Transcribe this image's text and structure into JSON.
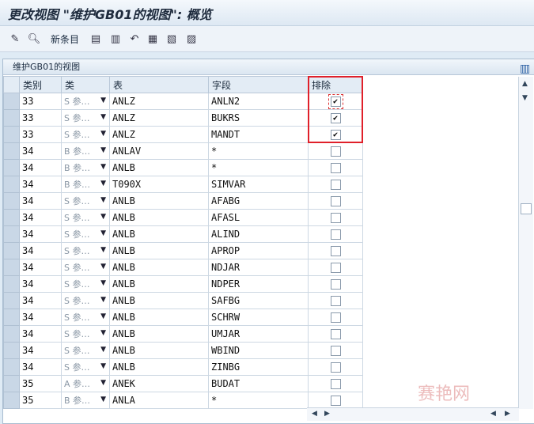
{
  "window": {
    "title": "更改视图 \"维护GB01的视图\": 概览"
  },
  "toolbar": {
    "new_entries_label": "新条目",
    "icons": [
      "edit-icon",
      "find-icon",
      "copy-icon",
      "delete-icon",
      "undo-icon",
      "select-all-icon",
      "select-block-icon",
      "deselect-all-icon"
    ]
  },
  "panel": {
    "title": "维护GB01的视图"
  },
  "table": {
    "headers": {
      "category": "类别",
      "class": "类",
      "table": "表",
      "field": "字段",
      "exclude": "排除"
    },
    "rows": [
      {
        "cat": "33",
        "cls": "S 参…",
        "tab": "ANLZ",
        "field": "ANLN2",
        "ex": true
      },
      {
        "cat": "33",
        "cls": "S 参…",
        "tab": "ANLZ",
        "field": "BUKRS",
        "ex": true
      },
      {
        "cat": "33",
        "cls": "S 参…",
        "tab": "ANLZ",
        "field": "MANDT",
        "ex": true
      },
      {
        "cat": "34",
        "cls": "B 参…",
        "tab": "ANLAV",
        "field": "*",
        "ex": false
      },
      {
        "cat": "34",
        "cls": "B 参…",
        "tab": "ANLB",
        "field": "*",
        "ex": false
      },
      {
        "cat": "34",
        "cls": "B 参…",
        "tab": "T090X",
        "field": "SIMVAR",
        "ex": false
      },
      {
        "cat": "34",
        "cls": "S 参…",
        "tab": "ANLB",
        "field": "AFABG",
        "ex": false
      },
      {
        "cat": "34",
        "cls": "S 参…",
        "tab": "ANLB",
        "field": "AFASL",
        "ex": false
      },
      {
        "cat": "34",
        "cls": "S 参…",
        "tab": "ANLB",
        "field": "ALIND",
        "ex": false
      },
      {
        "cat": "34",
        "cls": "S 参…",
        "tab": "ANLB",
        "field": "APROP",
        "ex": false
      },
      {
        "cat": "34",
        "cls": "S 参…",
        "tab": "ANLB",
        "field": "NDJAR",
        "ex": false
      },
      {
        "cat": "34",
        "cls": "S 参…",
        "tab": "ANLB",
        "field": "NDPER",
        "ex": false
      },
      {
        "cat": "34",
        "cls": "S 参…",
        "tab": "ANLB",
        "field": "SAFBG",
        "ex": false
      },
      {
        "cat": "34",
        "cls": "S 参…",
        "tab": "ANLB",
        "field": "SCHRW",
        "ex": false
      },
      {
        "cat": "34",
        "cls": "S 参…",
        "tab": "ANLB",
        "field": "UMJAR",
        "ex": false
      },
      {
        "cat": "34",
        "cls": "S 参…",
        "tab": "ANLB",
        "field": "WBIND",
        "ex": false
      },
      {
        "cat": "34",
        "cls": "S 参…",
        "tab": "ANLB",
        "field": "ZINBG",
        "ex": false
      },
      {
        "cat": "35",
        "cls": "A 参…",
        "tab": "ANEK",
        "field": "BUDAT",
        "ex": false
      },
      {
        "cat": "35",
        "cls": "B 参…",
        "tab": "ANLA",
        "field": "*",
        "ex": false
      }
    ]
  },
  "watermark": "赛艳网",
  "colors": {
    "highlight": "#e0202a",
    "header_bg": "#e3ecf5",
    "selector_bg": "#c9d7e6"
  }
}
